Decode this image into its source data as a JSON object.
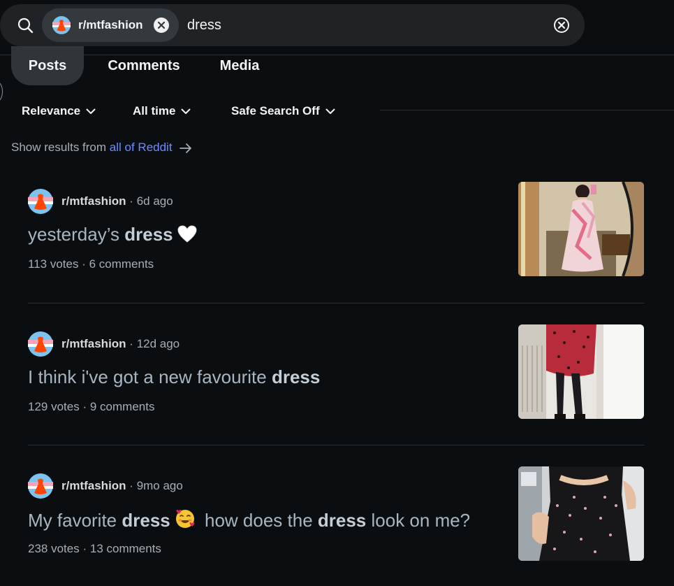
{
  "search": {
    "subreddit_chip": "r/mtfashion",
    "query": "dress"
  },
  "tabs": [
    {
      "label": "Posts",
      "active": true
    },
    {
      "label": "Comments",
      "active": false
    },
    {
      "label": "Media",
      "active": false
    }
  ],
  "filters": {
    "sort": "Relevance",
    "time": "All time",
    "safe_search": "Safe Search Off"
  },
  "show_results": {
    "prefix": "Show results from",
    "link": "all of Reddit"
  },
  "posts": [
    {
      "subreddit": "r/mtfashion",
      "age": "6d ago",
      "title_parts": [
        "yesterday’s ",
        "dress"
      ],
      "emoji": "white-heart-icon",
      "votes": "113 votes",
      "comments": "6 comments"
    },
    {
      "subreddit": "r/mtfashion",
      "age": "12d ago",
      "title_parts": [
        "I think i've got a new favourite ",
        "dress"
      ],
      "votes": "129 votes",
      "comments": "9 comments"
    },
    {
      "subreddit": "r/mtfashion",
      "age": "9mo ago",
      "title_parts": [
        "My favorite ",
        "dress",
        " how does the ",
        "dress",
        " look on me?"
      ],
      "emoji": "smiling-face-with-hearts-icon",
      "votes": "238 votes",
      "comments": "13 comments"
    }
  ],
  "colors": {
    "background": "#0b0e11",
    "link": "#6d8cff",
    "avatar_bg": "#ff4500",
    "chip_bg": "#33393d"
  }
}
